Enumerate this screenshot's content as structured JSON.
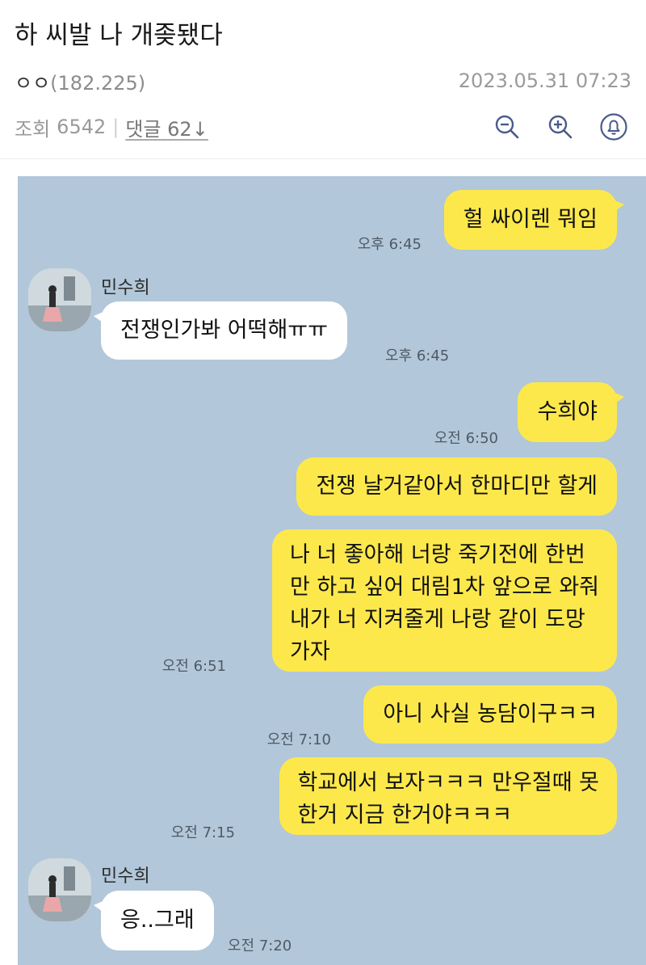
{
  "post": {
    "title": "하 씨발 나 개좆됐다",
    "author": "ㅇㅇ",
    "ip": "(182.225)",
    "datetime": "2023.05.31 07:23",
    "views_label": "조회",
    "views": "6542",
    "comments_label": "댓글",
    "comments": "62",
    "comments_arrow": "↓"
  },
  "icons": [
    "zoom-out-icon",
    "zoom-in-icon",
    "bell-icon"
  ],
  "chat": {
    "background": "#b2c7d9",
    "my_bubble_color": "#fde84c",
    "other_bubble_color": "#ffffff",
    "messages": [
      {
        "from": "me",
        "lines": [
          "헐 싸이렌 뭐임"
        ],
        "time": "오후 6:45"
      },
      {
        "from": "other",
        "sender": "민수희",
        "lines": [
          "전쟁인가봐 어떡해ㅠㅠ"
        ],
        "time": "오후 6:45"
      },
      {
        "from": "me",
        "lines": [
          "수희야"
        ],
        "time": "오전 6:50"
      },
      {
        "from": "me",
        "lines": [
          "전쟁 날거같아서 한마디만 할게"
        ],
        "time": ""
      },
      {
        "from": "me",
        "lines": [
          "나 너 좋아해 너랑 죽기전에 한번",
          "만 하고 싶어 대림1차 앞으로 와줘",
          "내가 너 지켜줄게 나랑 같이 도망",
          "가자"
        ],
        "time": "오전 6:51"
      },
      {
        "from": "me",
        "lines": [
          "아니 사실 농담이구ㅋㅋ"
        ],
        "time": "오전 7:10"
      },
      {
        "from": "me",
        "lines": [
          "학교에서 보자ㅋㅋㅋ 만우절때 못",
          "한거 지금 한거야ㅋㅋㅋ"
        ],
        "time": "오전 7:15"
      },
      {
        "from": "other",
        "sender": "민수희",
        "lines": [
          "응..그래"
        ],
        "time": "오전 7:20"
      }
    ]
  }
}
